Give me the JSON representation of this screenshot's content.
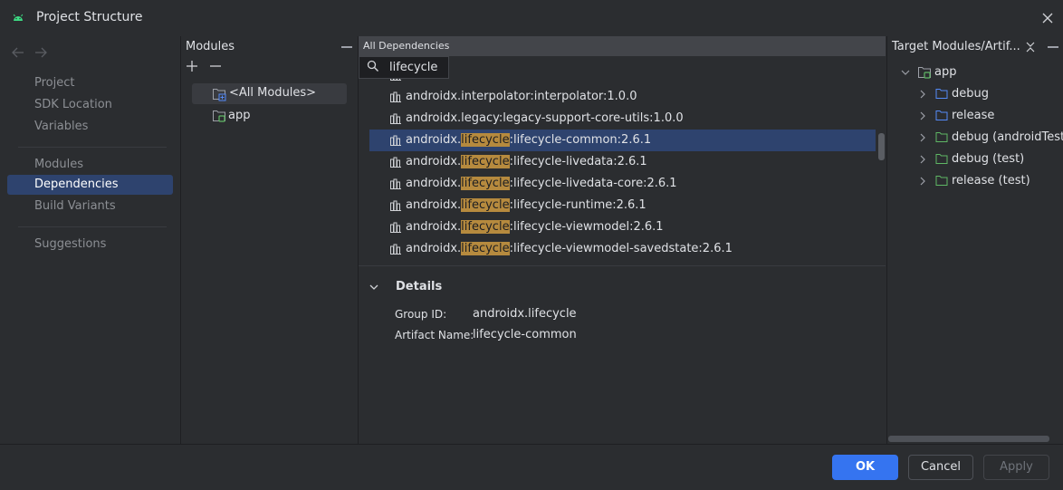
{
  "window": {
    "title": "Project Structure",
    "app_icon": "android-icon",
    "close_icon": "close-icon"
  },
  "nav": {
    "back_icon": "arrow-left-icon",
    "forward_icon": "arrow-right-icon",
    "items": [
      {
        "label": "Project"
      },
      {
        "label": "SDK Location"
      },
      {
        "label": "Variables"
      },
      {
        "label": "Modules"
      },
      {
        "label": "Dependencies",
        "selected": true
      },
      {
        "label": "Build Variants"
      },
      {
        "label": "Suggestions"
      }
    ]
  },
  "modules": {
    "title": "Modules",
    "items": [
      {
        "label": "<All Modules>",
        "selected": true
      },
      {
        "label": "app"
      }
    ]
  },
  "dependencies": {
    "header": "All Dependencies",
    "search": {
      "value": "lifecycle",
      "placeholder": ""
    },
    "rows": [
      {
        "pre": "",
        "hl": "",
        "post": ""
      },
      {
        "pre": "androidx.interpolator:interpolator:1.0.0",
        "hl": "",
        "post": ""
      },
      {
        "pre": "androidx.legacy:legacy-support-core-utils:1.0.0",
        "hl": "",
        "post": ""
      },
      {
        "pre": "androidx.",
        "hl": "lifecycle",
        "post": ":lifecycle-common:2.6.1",
        "selected": true
      },
      {
        "pre": "androidx.",
        "hl": "lifecycle",
        "post": ":lifecycle-livedata:2.6.1"
      },
      {
        "pre": "androidx.",
        "hl": "lifecycle",
        "post": ":lifecycle-livedata-core:2.6.1"
      },
      {
        "pre": "androidx.",
        "hl": "lifecycle",
        "post": ":lifecycle-runtime:2.6.1"
      },
      {
        "pre": "androidx.",
        "hl": "lifecycle",
        "post": ":lifecycle-viewmodel:2.6.1"
      },
      {
        "pre": "androidx.",
        "hl": "lifecycle",
        "post": ":lifecycle-viewmodel-savedstate:2.6.1"
      }
    ]
  },
  "details": {
    "title": "Details",
    "group_id_label": "Group ID:",
    "group_id": "androidx.lifecycle",
    "artifact_label": "Artifact Name:",
    "artifact": "lifecycle-common"
  },
  "target": {
    "title": "Target Modules/Artif...",
    "root": "app",
    "children": [
      {
        "label": "debug",
        "color": "#548af7"
      },
      {
        "label": "release",
        "color": "#548af7"
      },
      {
        "label": "debug (androidTest)",
        "color": "#5fb865"
      },
      {
        "label": "debug (test)",
        "color": "#5fb865"
      },
      {
        "label": "release (test)",
        "color": "#5fb865"
      }
    ]
  },
  "footer": {
    "ok": "OK",
    "cancel": "Cancel",
    "apply": "Apply"
  },
  "colors": {
    "accent": "#3574f0",
    "selection": "#2e436e",
    "highlight": "#b68a3e",
    "module_green": "#5fb865",
    "folder_blue": "#548af7"
  }
}
